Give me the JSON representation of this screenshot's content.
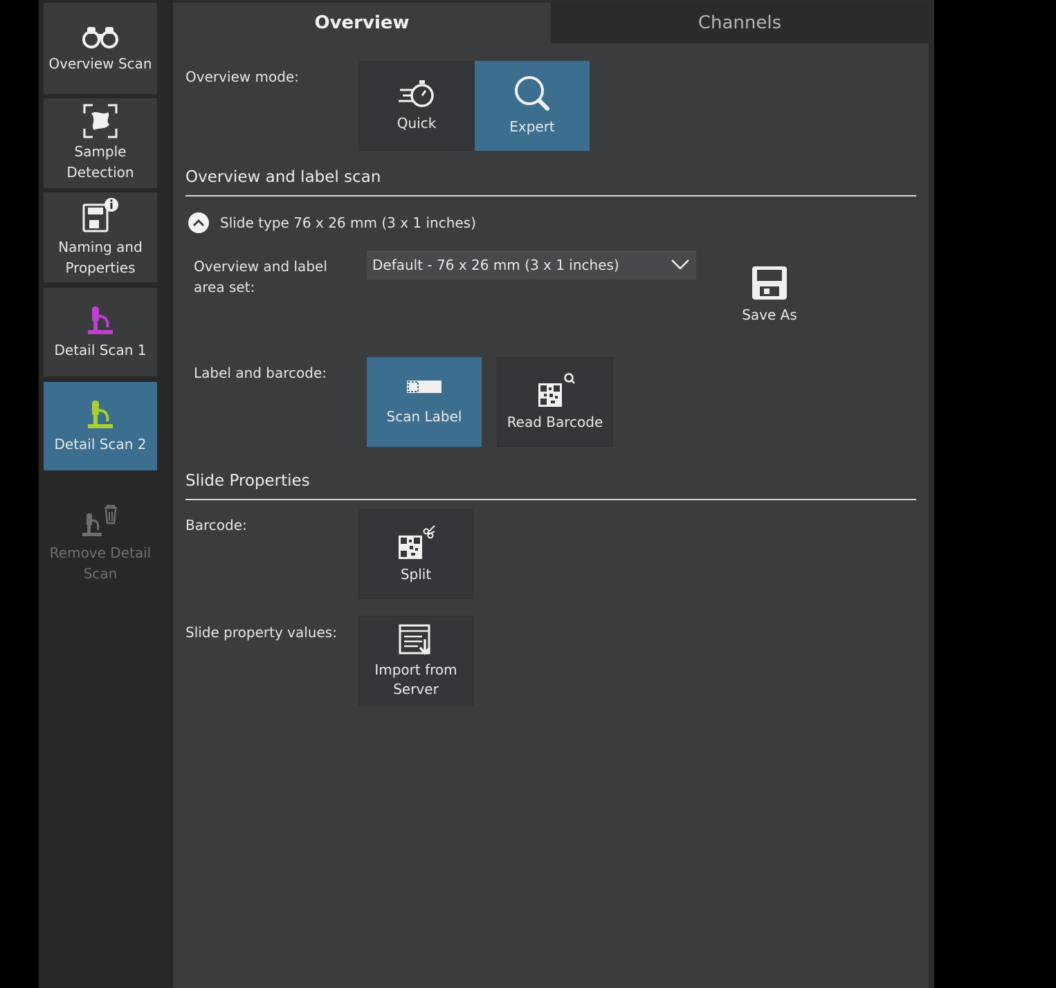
{
  "sidebar": {
    "items": [
      {
        "label": "Overview Scan",
        "icon": "binoculars-icon"
      },
      {
        "label": "Sample Detection",
        "icon": "sample-detection-icon"
      },
      {
        "label": "Naming and Properties",
        "icon": "naming-properties-icon"
      },
      {
        "label": "Detail Scan 1",
        "icon": "microscope-icon",
        "icon_color": "#c040d0"
      },
      {
        "label": "Detail Scan 2",
        "icon": "microscope-icon",
        "icon_color": "#a8d030"
      },
      {
        "label": "Remove Detail Scan",
        "icon": "remove-microscope-icon"
      }
    ]
  },
  "tabs": {
    "overview": "Overview",
    "channels": "Channels"
  },
  "overview_mode": {
    "label": "Overview mode:",
    "quick": "Quick",
    "expert": "Expert"
  },
  "overview_label_scan": {
    "title": "Overview and label scan",
    "slide_type": "Slide type 76 x 26 mm (3 x 1 inches)",
    "area_set_label": "Overview and label area set:",
    "area_set_value": "Default - 76 x 26 mm (3 x 1 inches)",
    "save_as": "Save As",
    "label_barcode_label": "Label and barcode:",
    "scan_label": "Scan Label",
    "read_barcode": "Read Barcode"
  },
  "slide_properties": {
    "title": "Slide Properties",
    "barcode_label": "Barcode:",
    "split": "Split",
    "values_label": "Slide property values:",
    "import": "Import from Server"
  },
  "colors": {
    "accent": "#3b6e8f",
    "panel": "#3b3c3e",
    "sidebar": "#282828"
  }
}
